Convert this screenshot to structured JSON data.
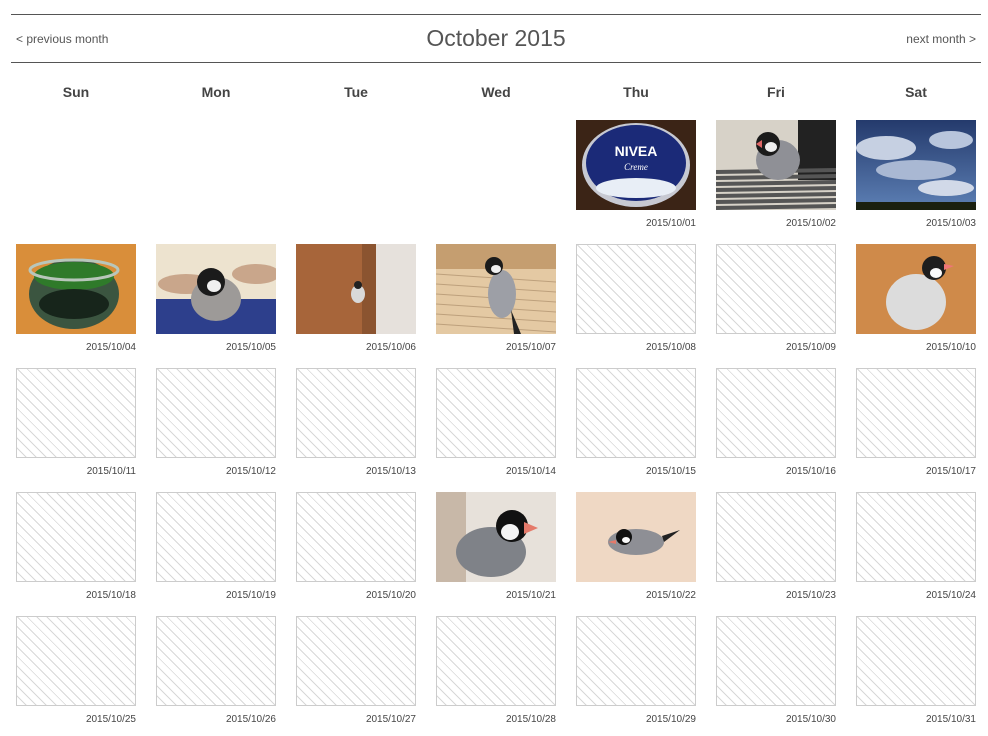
{
  "nav": {
    "title": "October 2015",
    "previous_label": "< previous month",
    "next_label": "next month >"
  },
  "weekdays": [
    "Sun",
    "Mon",
    "Tue",
    "Wed",
    "Thu",
    "Fri",
    "Sat"
  ],
  "days": [
    {
      "date": "2015/10/01",
      "photo": "nivea-tin"
    },
    {
      "date": "2015/10/02",
      "photo": "bird-on-striped-cloth"
    },
    {
      "date": "2015/10/03",
      "photo": "cloudy-sky"
    },
    {
      "date": "2015/10/04",
      "photo": "moss-jar"
    },
    {
      "date": "2015/10/05",
      "photo": "bird-held-in-hand"
    },
    {
      "date": "2015/10/06",
      "photo": "bird-on-door"
    },
    {
      "date": "2015/10/07",
      "photo": "bird-on-wood-floor"
    },
    {
      "date": "2015/10/08",
      "photo": null
    },
    {
      "date": "2015/10/09",
      "photo": null
    },
    {
      "date": "2015/10/10",
      "photo": "bird-on-table"
    },
    {
      "date": "2015/10/11",
      "photo": null
    },
    {
      "date": "2015/10/12",
      "photo": null
    },
    {
      "date": "2015/10/13",
      "photo": null
    },
    {
      "date": "2015/10/14",
      "photo": null
    },
    {
      "date": "2015/10/15",
      "photo": null
    },
    {
      "date": "2015/10/16",
      "photo": null
    },
    {
      "date": "2015/10/17",
      "photo": null
    },
    {
      "date": "2015/10/18",
      "photo": null
    },
    {
      "date": "2015/10/19",
      "photo": null
    },
    {
      "date": "2015/10/20",
      "photo": null
    },
    {
      "date": "2015/10/21",
      "photo": "bird-closeup"
    },
    {
      "date": "2015/10/22",
      "photo": "bird-on-sand"
    },
    {
      "date": "2015/10/23",
      "photo": null
    },
    {
      "date": "2015/10/24",
      "photo": null
    },
    {
      "date": "2015/10/25",
      "photo": null
    },
    {
      "date": "2015/10/26",
      "photo": null
    },
    {
      "date": "2015/10/27",
      "photo": null
    },
    {
      "date": "2015/10/28",
      "photo": null
    },
    {
      "date": "2015/10/29",
      "photo": null
    },
    {
      "date": "2015/10/30",
      "photo": null
    },
    {
      "date": "2015/10/31",
      "photo": null
    }
  ]
}
